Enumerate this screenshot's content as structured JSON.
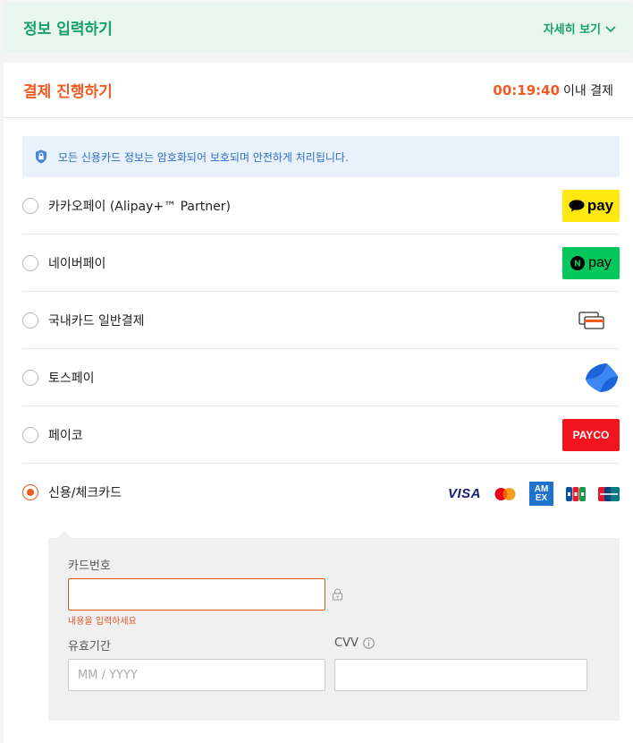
{
  "info": {
    "title": "정보 입력하기",
    "more_label": "자세히 보기"
  },
  "payment": {
    "title": "결제 진행하기",
    "timer": "00:19:40",
    "timer_suffix": "이내 결제",
    "notice": "모든 신용카드 정보는 암호화되어 보호되며 안전하게 처리됩니다."
  },
  "methods": [
    {
      "label": "카카오페이 (Alipay+™ Partner)",
      "logo": "pay",
      "selected": false
    },
    {
      "label": "네이버페이",
      "logo": "pay",
      "selected": false
    },
    {
      "label": "국내카드 일반결제",
      "logo": "card-icon",
      "selected": false
    },
    {
      "label": "토스페이",
      "logo": "toss-icon",
      "selected": false
    },
    {
      "label": "페이코",
      "logo": "PAYCO",
      "selected": false
    },
    {
      "label": "신용/체크카드",
      "logo": "card-brands",
      "selected": true
    }
  ],
  "card_brands": {
    "visa": "VISA",
    "amex_top": "AM",
    "amex_bottom": "EX"
  },
  "card_form": {
    "card_number_label": "카드번호",
    "card_number_value": "",
    "card_number_error": "내용을 입력하세요",
    "expiry_label": "유효기간",
    "expiry_placeholder": "MM / YYYY",
    "cvv_label": "CVV"
  },
  "colors": {
    "accent": "#f15a22",
    "green": "#16a06a",
    "info_blue": "#2c6fc2"
  }
}
